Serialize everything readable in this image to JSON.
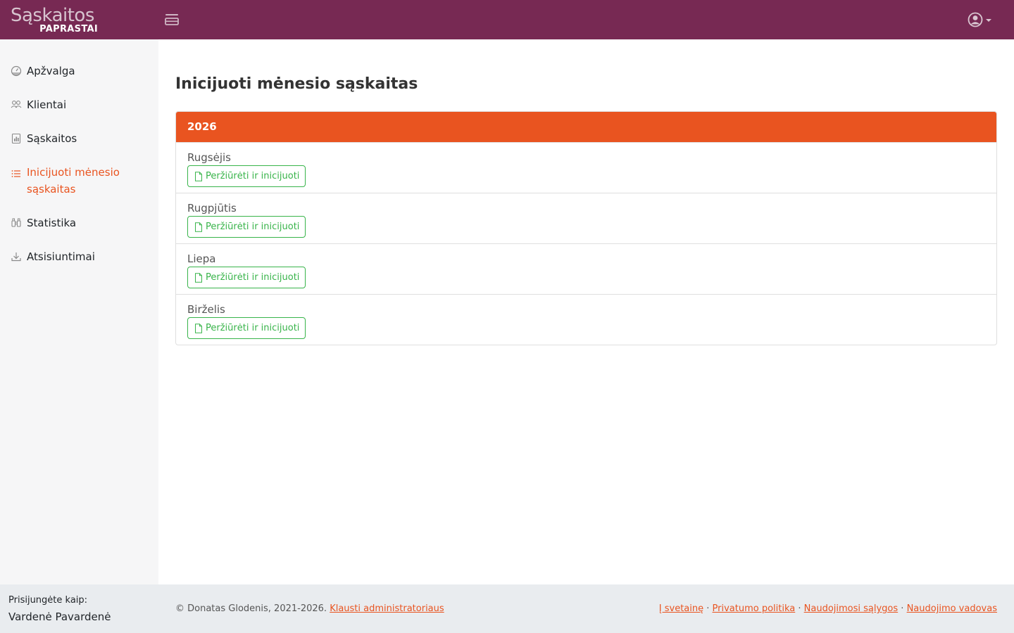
{
  "brand": {
    "title": "Sąskaitos",
    "subtitle": "PAPRASTAI"
  },
  "topbar": {
    "menu_toggle_icon": "hamburger-icon",
    "user_icon": "user-circle-icon",
    "caret_icon": "caret-down-icon"
  },
  "sidebar": {
    "items": [
      {
        "label": "Apžvalga",
        "icon": "dashboard-gauge-icon",
        "active": false
      },
      {
        "label": "Klientai",
        "icon": "people-icon",
        "active": false
      },
      {
        "label": "Sąskaitos",
        "icon": "invoice-chart-icon",
        "active": false
      },
      {
        "label": "Inicijuoti mėnesio sąskaitas",
        "icon": "list-icon",
        "active": true
      },
      {
        "label": "Statistika",
        "icon": "binoculars-icon",
        "active": false
      },
      {
        "label": "Atsisiuntimai",
        "icon": "download-icon",
        "active": false
      }
    ]
  },
  "main": {
    "title": "Inicijuoti mėnesio sąskaitas",
    "card": {
      "year": "2026",
      "months": [
        {
          "name": "Rugsėjis",
          "button": "Peržiūrėti ir inicijuoti"
        },
        {
          "name": "Rugpjūtis",
          "button": "Peržiūrėti ir inicijuoti"
        },
        {
          "name": "Liepa",
          "button": "Peržiūrėti ir inicijuoti"
        },
        {
          "name": "Birželis",
          "button": "Peržiūrėti ir inicijuoti"
        }
      ]
    }
  },
  "footer": {
    "signed_in_label": "Prisijungėte kaip:",
    "user_name": "Vardenė Pavardenė",
    "copyright": "© Donatas Glodenis, 2021-2026.",
    "contact_link": "Klausti administratoriaus",
    "links": [
      "Į svetainę",
      "Privatumo politika",
      "Naudojimosi sąlygos",
      "Naudojimo vadovas"
    ],
    "separator": " · "
  },
  "colors": {
    "topbar": "#772953",
    "accent": "#e95420",
    "success": "#38b44a",
    "sidebar_bg": "#f6f6f7",
    "footer_bg": "#e9ecef"
  }
}
